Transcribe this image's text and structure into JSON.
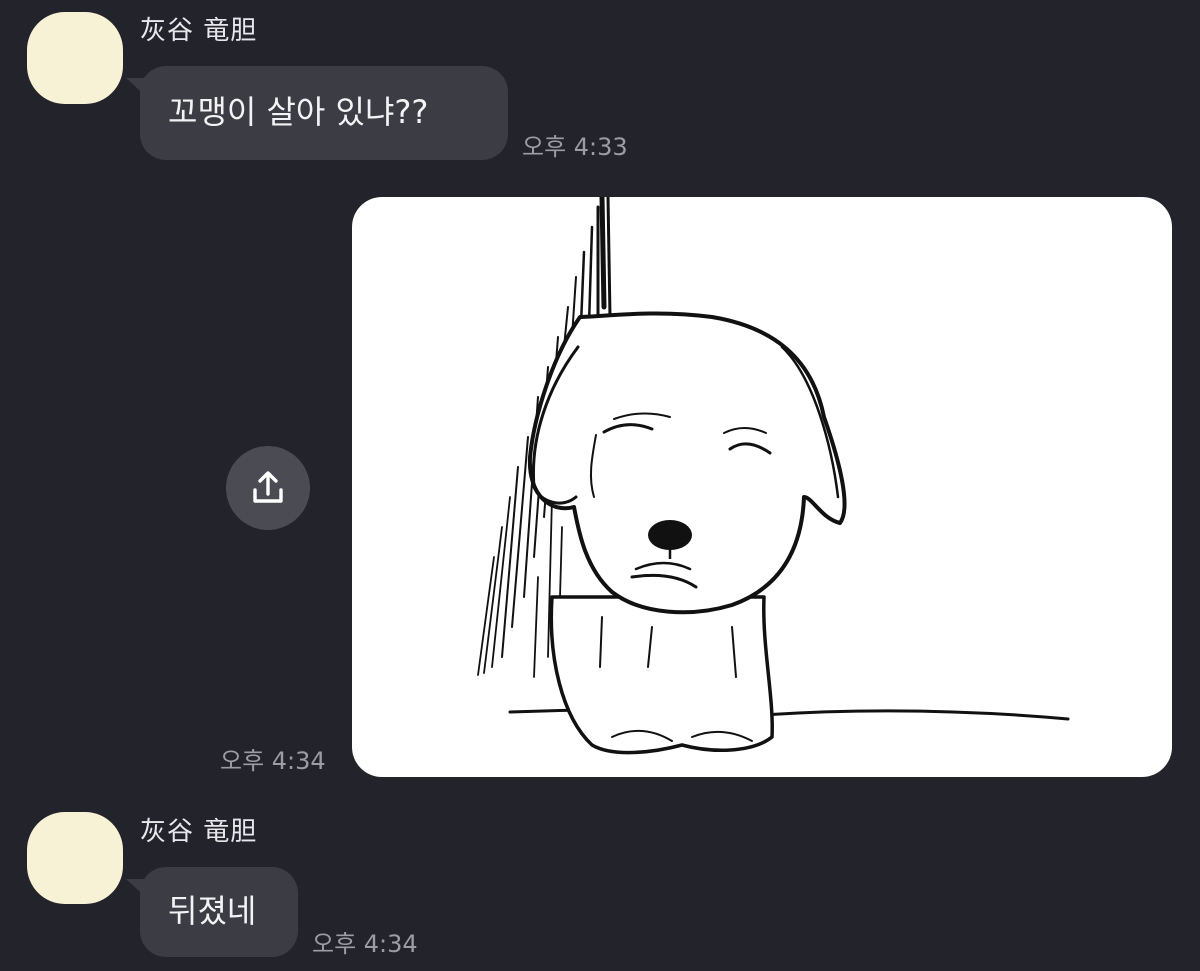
{
  "messages": [
    {
      "sender": "灰谷 竜胆",
      "text": "꼬맹이 살아 있냐??",
      "time": "오후 4:33"
    },
    {
      "time": "오후 4:34",
      "attachment": "dog-sketch-image"
    },
    {
      "sender": "灰谷 竜胆",
      "text": "뒤졌네",
      "time": "오후 4:34"
    }
  ],
  "share_icon": "share-upload-icon",
  "colors": {
    "background": "#23232b",
    "bubble": "#3b3c44",
    "avatar": "#f7f2d6",
    "time_text": "#9c9ca6",
    "share_button": "#4a4b53"
  }
}
